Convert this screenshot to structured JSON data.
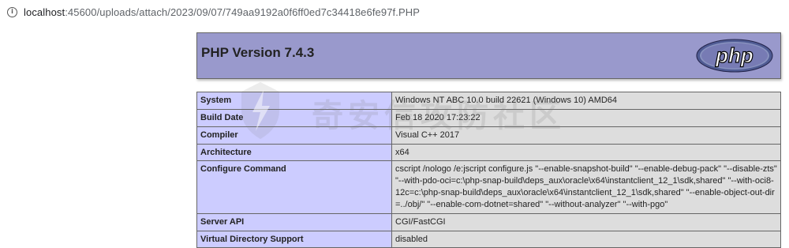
{
  "browser": {
    "url_host": "localhost",
    "url_path": ":45600/uploads/attach/2023/09/07/749aa9192a0f6ff0ed7c34418e6fe97f.PHP",
    "info_icon": "info-icon"
  },
  "header": {
    "title": "PHP Version 7.4.3",
    "logo_text": "php",
    "logo_color": "#ffffff",
    "logo_bg": "#6e6fb1"
  },
  "watermark": {
    "text": "奇安信攻防社区"
  },
  "rows": [
    {
      "key": "System",
      "value": "Windows NT ABC 10.0 build 22621 (Windows 10) AMD64"
    },
    {
      "key": "Build Date",
      "value": "Feb 18 2020 17:23:22"
    },
    {
      "key": "Compiler",
      "value": "Visual C++ 2017"
    },
    {
      "key": "Architecture",
      "value": "x64"
    },
    {
      "key": "Configure Command",
      "value": "cscript /nologo /e:jscript configure.js \"--enable-snapshot-build\" \"--enable-debug-pack\" \"--disable-zts\" \"--with-pdo-oci=c:\\php-snap-build\\deps_aux\\oracle\\x64\\instantclient_12_1\\sdk,shared\" \"--with-oci8-12c=c:\\php-snap-build\\deps_aux\\oracle\\x64\\instantclient_12_1\\sdk,shared\" \"--enable-object-out-dir=../obj/\" \"--enable-com-dotnet=shared\" \"--without-analyzer\" \"--with-pgo\""
    },
    {
      "key": "Server API",
      "value": "CGI/FastCGI"
    },
    {
      "key": "Virtual Directory Support",
      "value": "disabled"
    }
  ]
}
